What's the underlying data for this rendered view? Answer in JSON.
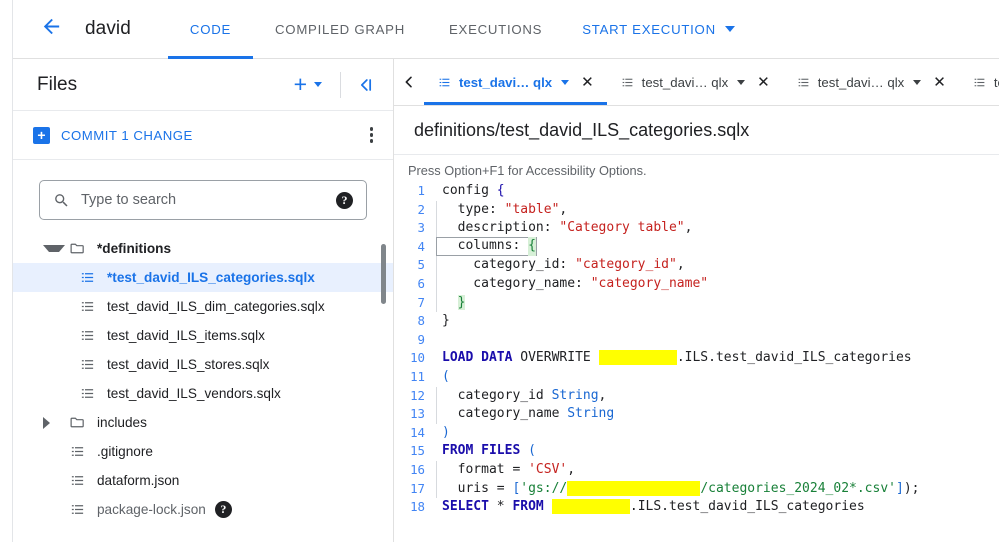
{
  "header": {
    "back_icon": "arrow-left-icon",
    "project_title": "david",
    "tabs": [
      {
        "label": "CODE",
        "active": true
      },
      {
        "label": "COMPILED GRAPH",
        "active": false
      },
      {
        "label": "EXECUTIONS",
        "active": false
      }
    ],
    "start_execution": {
      "label": "START EXECUTION",
      "caret_icon": "chevron-down-icon"
    }
  },
  "files_panel": {
    "title": "Files",
    "add_button": {
      "icon": "plus-icon",
      "caret_icon": "chevron-down-icon"
    },
    "collapse_button": {
      "icon": "collapse-panel-icon",
      "label": "<|"
    },
    "commit": {
      "badge": "+",
      "label": "COMMIT 1 CHANGE",
      "overflow_icon": "kebab-menu-icon"
    },
    "search": {
      "icon": "search-icon",
      "value": "",
      "placeholder": "Type to search",
      "help_icon": "help-icon",
      "help_glyph": "?"
    },
    "tree": [
      {
        "label": "*definitions",
        "type": "folder",
        "expanded": true,
        "indent": 0,
        "bold": true,
        "selected": false
      },
      {
        "label": "*test_david_ILS_categories.sqlx",
        "type": "file",
        "indent": 1,
        "selected": true
      },
      {
        "label": "test_david_ILS_dim_categories.sqlx",
        "type": "file",
        "indent": 1,
        "selected": false
      },
      {
        "label": "test_david_ILS_items.sqlx",
        "type": "file",
        "indent": 1,
        "selected": false
      },
      {
        "label": "test_david_ILS_stores.sqlx",
        "type": "file",
        "indent": 1,
        "selected": false
      },
      {
        "label": "test_david_ILS_vendors.sqlx",
        "type": "file",
        "indent": 1,
        "selected": false
      },
      {
        "label": "includes",
        "type": "folder",
        "expanded": false,
        "indent": 0,
        "selected": false
      },
      {
        "label": ".gitignore",
        "type": "file",
        "indent": 0,
        "selected": false
      },
      {
        "label": "dataform.json",
        "type": "file",
        "indent": 0,
        "selected": false
      },
      {
        "label": "package-lock.json",
        "type": "file",
        "indent": 0,
        "selected": false,
        "muted": true,
        "help_glyph": "?"
      }
    ]
  },
  "editor": {
    "scroll_left_icon": "chevron-left-icon",
    "tabs": [
      {
        "label": "test_davi… qlx",
        "active": true,
        "icon": "file-icon",
        "caret_icon": "chevron-down-icon",
        "close_icon": "close-icon",
        "close_glyph": "✕"
      },
      {
        "label": "test_davi… qlx",
        "active": false,
        "icon": "file-icon",
        "caret_icon": "chevron-down-icon",
        "close_icon": "close-icon",
        "close_glyph": "✕"
      },
      {
        "label": "test_davi… qlx",
        "active": false,
        "icon": "file-icon",
        "caret_icon": "chevron-down-icon",
        "close_icon": "close-icon",
        "close_glyph": "✕"
      },
      {
        "label": "test_dav",
        "active": false,
        "icon": "file-icon",
        "caret_icon": "chevron-down-icon",
        "close_icon": "close-icon",
        "close_glyph": "✕"
      }
    ],
    "file_path": "definitions/test_david_ILS_categories.sqlx",
    "a11y_hint": "Press Option+F1 for Accessibility Options.",
    "lines": [
      {
        "n": "1",
        "text": "config {"
      },
      {
        "n": "2",
        "text": "  type: \"table\","
      },
      {
        "n": "3",
        "text": "  description: \"Category table\","
      },
      {
        "n": "4",
        "text": "  columns: {",
        "active": true
      },
      {
        "n": "5",
        "text": "    category_id: \"category_id\","
      },
      {
        "n": "6",
        "text": "    category_name: \"category_name\""
      },
      {
        "n": "7",
        "text": "  }"
      },
      {
        "n": "8",
        "text": "}"
      },
      {
        "n": "9",
        "text": ""
      },
      {
        "n": "10",
        "text": "LOAD DATA OVERWRITE ██████████.ILS.test_david_ILS_categories"
      },
      {
        "n": "11",
        "text": "("
      },
      {
        "n": "12",
        "text": "  category_id String,"
      },
      {
        "n": "13",
        "text": "  category_name String"
      },
      {
        "n": "14",
        "text": ")"
      },
      {
        "n": "15",
        "text": "FROM FILES ("
      },
      {
        "n": "16",
        "text": "  format = 'CSV',"
      },
      {
        "n": "17",
        "text": "  uris = ['gs://████████████████/categories_2024_02*.csv']);"
      },
      {
        "n": "18",
        "text": "SELECT * FROM ██████████.ILS.test_david_ILS_categories"
      }
    ]
  },
  "colors": {
    "accent": "#1a73e8",
    "keyword": "#1a0dab",
    "string": "#c5221f",
    "string_green": "#188038",
    "type": "#1967d2",
    "line_number": "#4285f4",
    "redaction": "#ffff00",
    "selected_row": "#e8f0fe"
  }
}
